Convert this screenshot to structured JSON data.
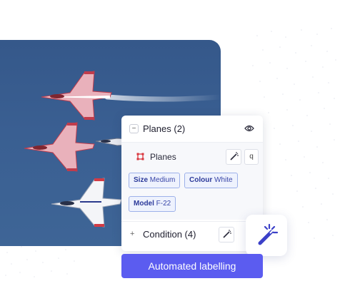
{
  "image": {
    "subject": "planes"
  },
  "panel": {
    "section": {
      "title": "Planes (2)",
      "collapse_icon": "minus-icon",
      "visibility_icon": "eye-icon"
    },
    "class_row": {
      "label": "Planes",
      "color": "#d9363e",
      "icon": "bounding-box-icon",
      "tool_icon": "magic-wand-icon",
      "extra_button": "q"
    },
    "attributes": [
      {
        "key": "Size",
        "value": "Medium"
      },
      {
        "key": "Colour",
        "value": "White"
      },
      {
        "key": "Model",
        "value": "F-22"
      }
    ],
    "condition": {
      "title": "Condition (4)",
      "expand_icon": "plus-icon",
      "tool_icon": "magic-wand-icon"
    }
  },
  "floating_action": {
    "icon": "magic-wand-icon",
    "accent": "#4a4fd6"
  },
  "cta": {
    "label": "Automated labelling",
    "color": "#5b5cf0"
  }
}
